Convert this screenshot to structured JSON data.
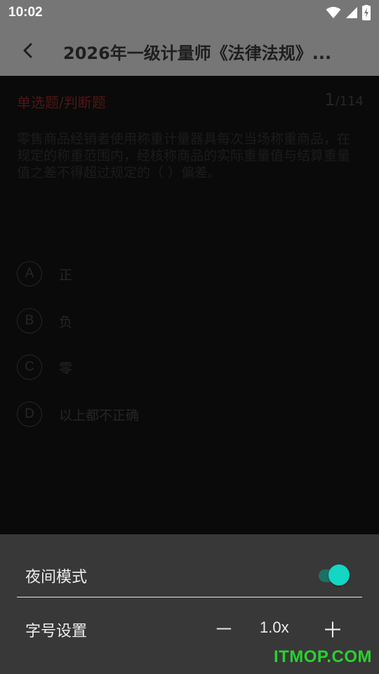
{
  "status_bar": {
    "time": "10:02",
    "icons": [
      "wifi-icon",
      "cell-signal-icon",
      "battery-charging-icon"
    ]
  },
  "app_bar": {
    "back_icon": "chevron-left-icon",
    "title": "2026年一级计量师《法律法规》..."
  },
  "question": {
    "type": "单选题/判断题",
    "current": "1",
    "total": "/114",
    "text": "零售商品经销者使用称重计量器具每次当场称重商品，在规定的称重范围内，经核称商品的实际重量值与结算重量值之差不得超过规定的（ ）偏差。",
    "options": [
      {
        "letter": "A",
        "text": "正"
      },
      {
        "letter": "B",
        "text": "负"
      },
      {
        "letter": "C",
        "text": "零"
      },
      {
        "letter": "D",
        "text": "以上都不正确"
      }
    ]
  },
  "settings": {
    "night_mode_label": "夜间模式",
    "night_mode_on": true,
    "font_size_label": "字号设置",
    "minus": "－",
    "font_size_value": "1.0x",
    "plus": "＋"
  },
  "colors": {
    "status_bar_bg": "#767676",
    "question_type": "#4e1616",
    "sheet_bg": "#383838",
    "toggle_accent": "#14d6c4",
    "watermark": "#2ad12f"
  },
  "watermark": "ITMOP.COM"
}
